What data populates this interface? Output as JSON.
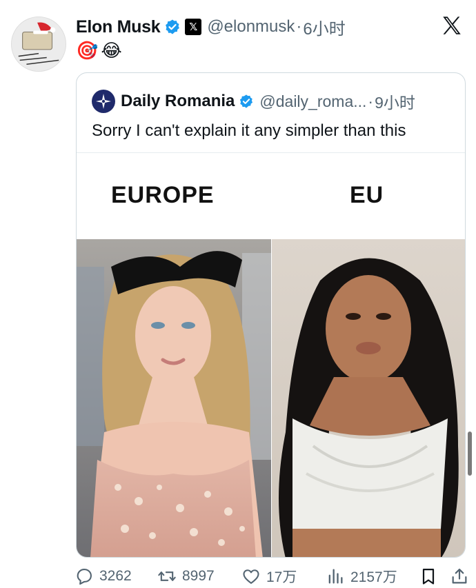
{
  "tweet": {
    "author_name": "Elon Musk",
    "handle": "@elonmusk",
    "separator": "·",
    "time": "6小时",
    "emojis": [
      "🎯",
      "😂"
    ]
  },
  "quote": {
    "author_name": "Daily Romania",
    "handle": "@daily_roma...",
    "separator": "·",
    "time": "9小时",
    "text": "Sorry I can't explain it any simpler than this",
    "meme_labels": {
      "left": "EUROPE",
      "right": "EU"
    }
  },
  "actions": {
    "replies": "3262",
    "retweets": "8997",
    "likes": "17万",
    "views": "2157万"
  },
  "icons": {
    "verified": "verified-badge-icon",
    "affiliation": "x-affiliation-icon",
    "logo": "x-logo-icon",
    "reply": "reply-icon",
    "retweet": "retweet-icon",
    "like": "heart-icon",
    "views": "views-chart-icon",
    "bookmark": "bookmark-icon",
    "share": "share-icon"
  },
  "colors": {
    "accent": "#1d9bf0",
    "secondary_text": "#536471",
    "text": "#0f1419",
    "border": "#cfd9de"
  }
}
